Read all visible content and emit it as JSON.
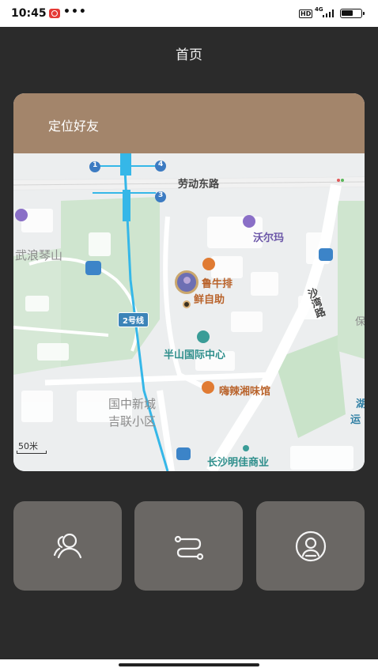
{
  "status_bar": {
    "time": "10:45",
    "dots": "•••",
    "hd": "HD",
    "network": "4G"
  },
  "header": {
    "title": "首页"
  },
  "card": {
    "title": "定位好友"
  },
  "map": {
    "roads": {
      "laodong_east": "劳动东路",
      "shawan": "沙湾路"
    },
    "pois": {
      "walmart": "沃尔玛",
      "restaurant_1": "鲁牛排",
      "restaurant_1b": "鲜自助",
      "banshan_center": "半山国际中心",
      "hot_xiang": "嗨辣湘味馆",
      "changsha_mingjia": "长沙明佳商业",
      "wulang_qinshan": "武浪琴山",
      "guozhong_xincheng": "国中新城",
      "jilian_xiaoqu": "吉联小区",
      "edge_hu": "湖",
      "edge_yun": "运",
      "edge_xu": "保"
    },
    "metro_line": "2号线",
    "exits": [
      "1",
      "4",
      "3"
    ],
    "scale": "50米"
  },
  "actions": [
    {
      "name": "friends-button",
      "icon": "users-icon"
    },
    {
      "name": "route-button",
      "icon": "route-icon"
    },
    {
      "name": "profile-button",
      "icon": "user-circle-icon"
    }
  ],
  "colors": {
    "background": "#2b2b2b",
    "card_header": "#a3856b",
    "action_button": "#6a6764",
    "metro_line": "#35b7e8"
  }
}
